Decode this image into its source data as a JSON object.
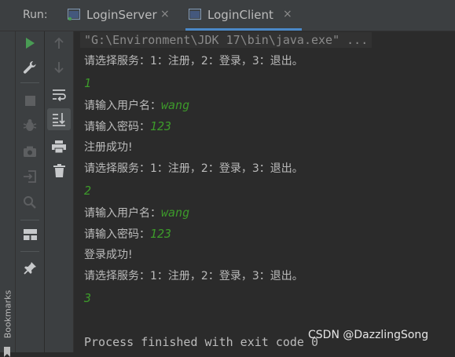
{
  "runbar": {
    "label": "Run:",
    "tabs": [
      {
        "title": "LoginServer",
        "close": "×"
      },
      {
        "title": "LoginClient",
        "close": "×"
      }
    ]
  },
  "sidebar": {
    "bookmarks_label": "Bookmarks"
  },
  "console": {
    "command": "\"G:\\Environment\\JDK 17\\bin\\java.exe\" ...",
    "lines": [
      {
        "kind": "out",
        "text": "请选择服务：1：注册，2：登录，3：退出。"
      },
      {
        "kind": "in",
        "text": "1"
      },
      {
        "kind": "mixed",
        "prompt": "请输入用户名：",
        "value": "wang"
      },
      {
        "kind": "mixed",
        "prompt": "请输入密码：",
        "value": "123"
      },
      {
        "kind": "out",
        "text": "注册成功!"
      },
      {
        "kind": "out",
        "text": "请选择服务：1：注册，2：登录，3：退出。"
      },
      {
        "kind": "in",
        "text": "2"
      },
      {
        "kind": "mixed",
        "prompt": "请输入用户名：",
        "value": "wang"
      },
      {
        "kind": "mixed",
        "prompt": "请输入密码：",
        "value": "123"
      },
      {
        "kind": "out",
        "text": "登录成功!"
      },
      {
        "kind": "out",
        "text": "请选择服务：1：注册，2：登录，3：退出。"
      },
      {
        "kind": "in",
        "text": "3"
      },
      {
        "kind": "out",
        "text": ""
      },
      {
        "kind": "finish",
        "text": "Process finished with exit code 0"
      }
    ]
  },
  "watermark": "CSDN @DazzlingSong",
  "colors": {
    "background": "#2b2b2b",
    "panel": "#3c3f41",
    "input_text": "#3d9a2b",
    "run_icon": "#499c54",
    "active_tab_underline": "#4a88c7"
  },
  "icons": {
    "toolbar_col1": [
      "run-icon",
      "wrench-icon",
      "stop-icon",
      "debug-bug-icon",
      "camera-snapshot-icon",
      "exit-login-icon",
      "search-gear-icon",
      "layout-icon",
      "pin-icon"
    ],
    "toolbar_col2": [
      "up-arrow-icon",
      "down-arrow-icon",
      "soft-wrap-icon",
      "scroll-to-end-icon",
      "print-icon",
      "trash-icon"
    ]
  }
}
